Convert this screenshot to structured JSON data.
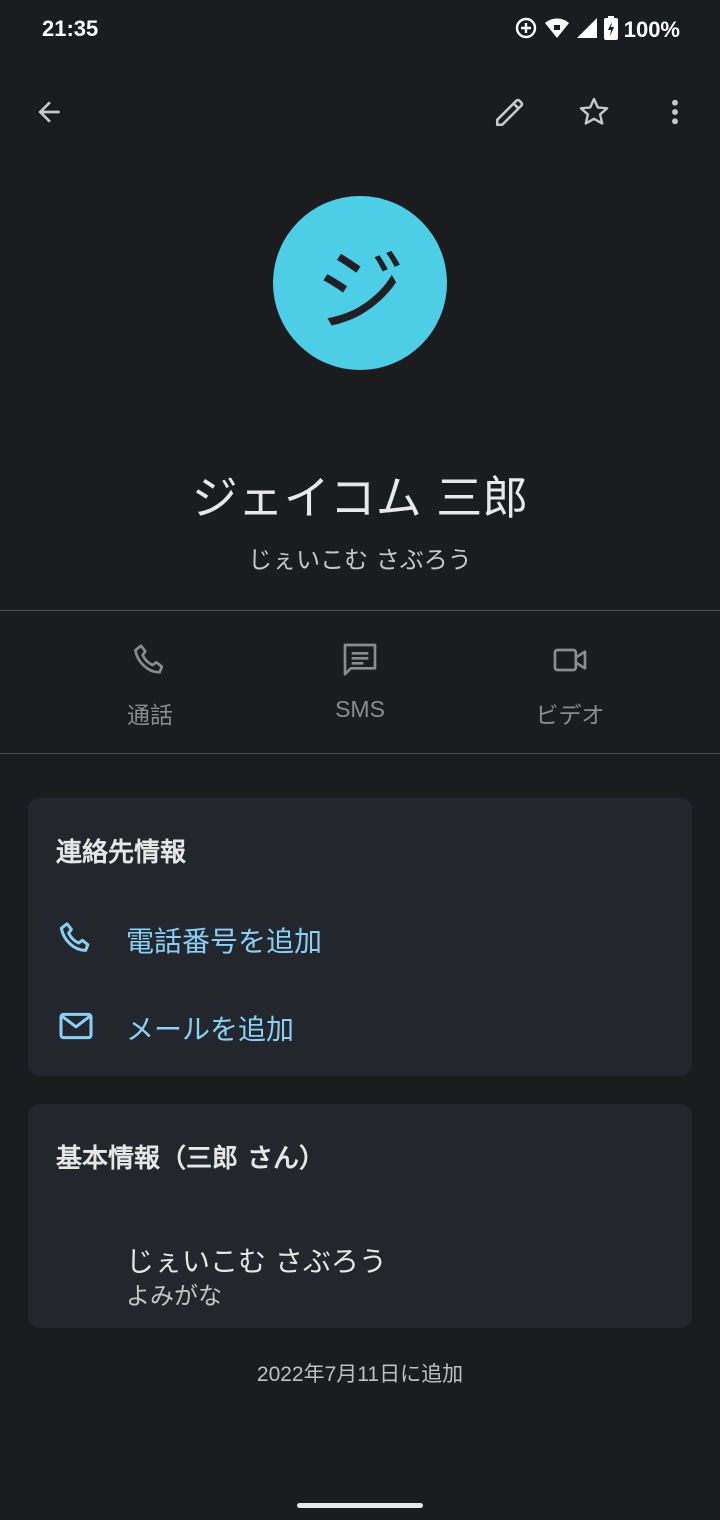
{
  "status_bar": {
    "time": "21:35",
    "battery": "100%"
  },
  "top_bar": {
    "back_icon": "arrow-left-icon",
    "edit_icon": "pencil-icon",
    "favorite_icon": "star-outline-icon",
    "more_icon": "more-vert-icon"
  },
  "contact": {
    "avatar_letter": "ジ",
    "avatar_color": "#4ecde6",
    "name": "ジェイコム 三郎",
    "phonetic": "じぇいこむ さぶろう"
  },
  "actions": [
    {
      "label": "通話",
      "icon": "phone-icon"
    },
    {
      "label": "SMS",
      "icon": "message-icon"
    },
    {
      "label": "ビデオ",
      "icon": "video-icon"
    }
  ],
  "contact_info": {
    "title": "連絡先情報",
    "add_phone": "電話番号を追加",
    "add_email": "メールを追加"
  },
  "basic_info": {
    "title": "基本情報（三郎 さん）",
    "value": "じぇいこむ さぶろう",
    "label": "よみがな"
  },
  "footer": {
    "added": "2022年7月11日に追加"
  },
  "colors": {
    "background": "#1b1c1f",
    "card": "#23272d",
    "accent": "#8ad0f5"
  }
}
